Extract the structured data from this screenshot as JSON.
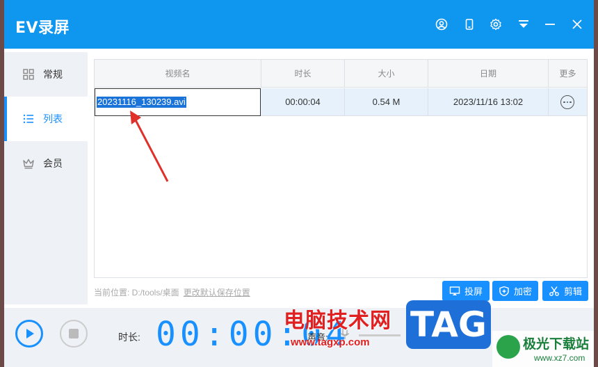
{
  "app": {
    "title": "EV录屏"
  },
  "sidebar": {
    "items": [
      {
        "label": "常规",
        "icon": "grid-icon"
      },
      {
        "label": "列表",
        "icon": "list-icon",
        "active": true
      },
      {
        "label": "会员",
        "icon": "crown-icon"
      }
    ]
  },
  "table": {
    "headers": [
      "视频名",
      "时长",
      "大小",
      "日期",
      "更多"
    ],
    "rows": [
      {
        "name": "20231116_130239.avi",
        "duration": "00:00:04",
        "size": "0.54 M",
        "date": "2023/11/16 13:02"
      }
    ]
  },
  "location": {
    "label": "当前位置: D:/tools/桌面",
    "link": "更改默认保存位置"
  },
  "actions": {
    "cast": "投屏",
    "encrypt": "加密",
    "cut": "剪辑"
  },
  "bottom": {
    "duration_label": "时长:",
    "timer": "00:00:04",
    "sound_label": "声音:"
  },
  "watermarks": {
    "cn": "电脑技术网",
    "url": "www.tagxp.com",
    "tag": "TAG",
    "site_cn": "极光下载站",
    "site_url": "www.xz7.com"
  },
  "colors": {
    "accent": "#0f96ee",
    "button": "#1890ff",
    "selection": "#1a73d9"
  }
}
